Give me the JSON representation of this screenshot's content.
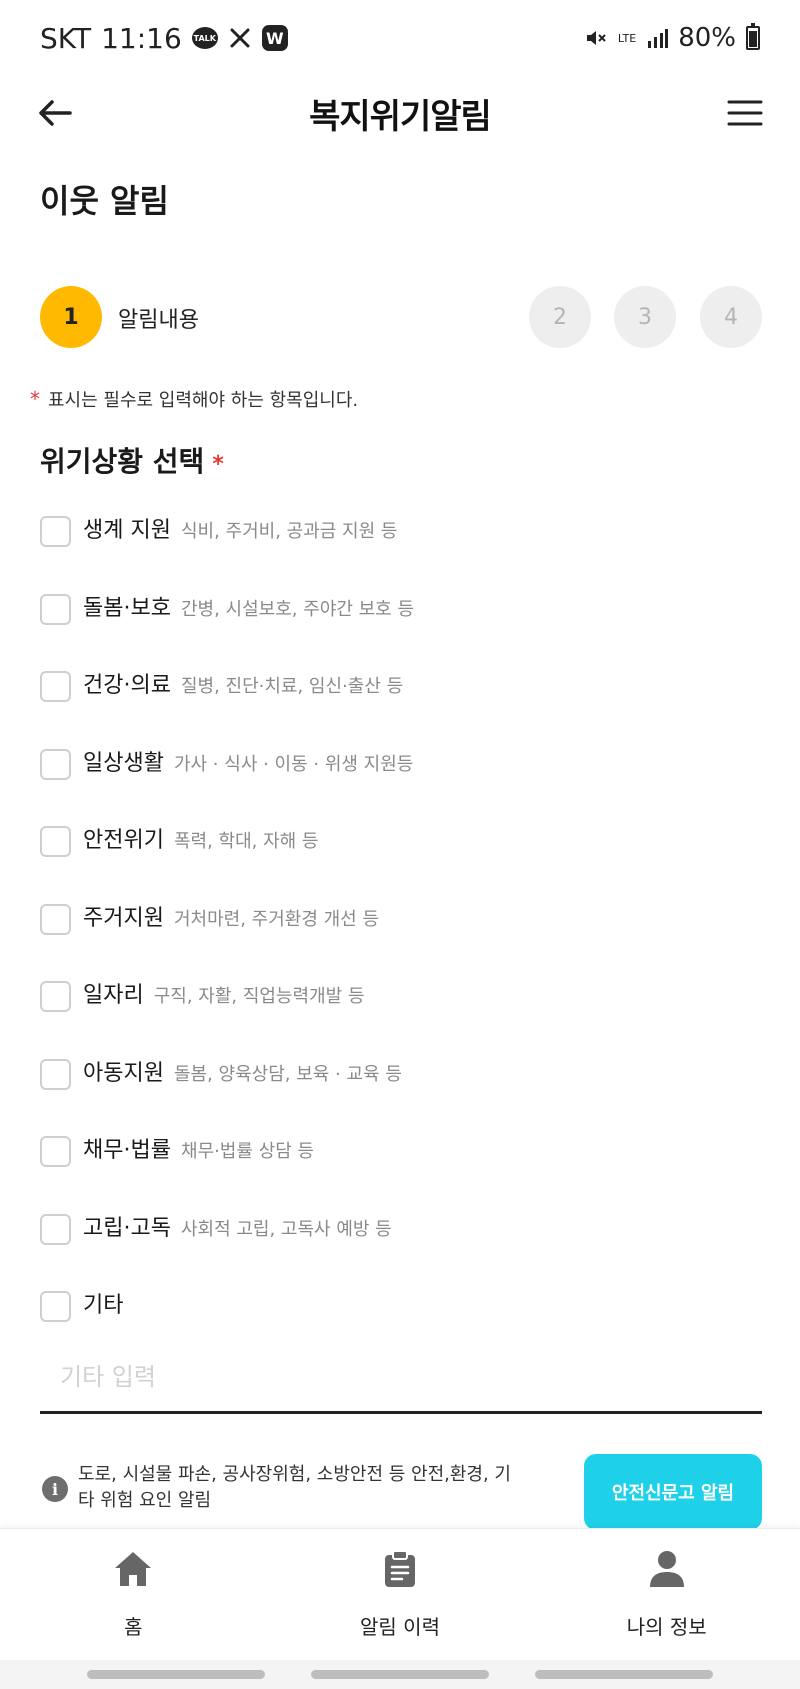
{
  "status_bar": {
    "carrier": "SKT",
    "time": "11:16",
    "talk_badge": "TALK",
    "w_badge": "W",
    "network": "LTE",
    "battery": "80%"
  },
  "header": {
    "title": "복지위기알림"
  },
  "page": {
    "title": "이웃 알림"
  },
  "stepper": {
    "active_step": "1",
    "active_label": "알림내용",
    "steps": [
      "2",
      "3",
      "4"
    ]
  },
  "required_note": {
    "asterisk": "*",
    "text": "표시는 필수로 입력해야 하는 항목입니다."
  },
  "section": {
    "title": "위기상황 선택",
    "required_mark": "*"
  },
  "options": [
    {
      "name": "생계 지원",
      "desc": "식비, 주거비, 공과금 지원 등"
    },
    {
      "name": "돌봄·보호",
      "desc": "간병, 시설보호, 주야간 보호 등"
    },
    {
      "name": "건강·의료",
      "desc": "질병, 진단·치료, 임신·출산 등"
    },
    {
      "name": "일상생활",
      "desc": "가사 · 식사 · 이동 · 위생 지원등"
    },
    {
      "name": "안전위기",
      "desc": "폭력, 학대, 자해 등"
    },
    {
      "name": "주거지원",
      "desc": "거처마련, 주거환경 개선 등"
    },
    {
      "name": "일자리",
      "desc": "구직, 자활, 직업능력개발 등"
    },
    {
      "name": "아동지원",
      "desc": "돌봄, 양육상담, 보육 · 교육 등"
    },
    {
      "name": "채무·법률",
      "desc": "채무·법률 상담 등"
    },
    {
      "name": "고립·고독",
      "desc": "사회적 고립, 고독사 예방 등"
    },
    {
      "name": "기타",
      "desc": ""
    }
  ],
  "other_input": {
    "placeholder": "기타 입력",
    "value": ""
  },
  "safety": {
    "text": "도로, 시설물 파손, 공사장위험, 소방안전 등 안전,환경, 기타 위험 요인 알림",
    "button_label": "안전신문고 알림"
  },
  "bottom_nav": {
    "home": "홈",
    "history": "알림 이력",
    "profile": "나의 정보"
  },
  "colors": {
    "accent_step": "#ffb900",
    "safety_button": "#1fd1e8",
    "required": "#e53935"
  }
}
